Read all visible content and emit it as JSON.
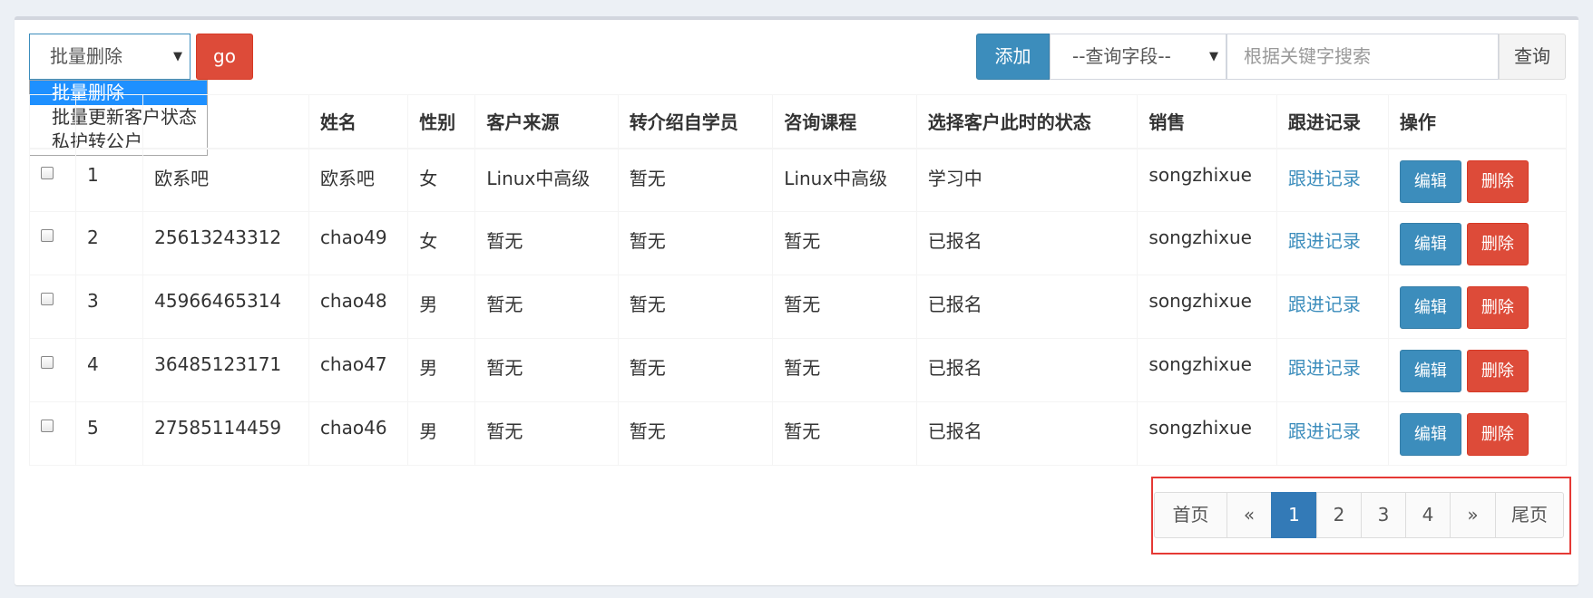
{
  "toolbar": {
    "bulk_selected": "批量删除",
    "bulk_options": [
      "批量删除",
      "批量更新客户状态",
      "私护转公户"
    ],
    "go_label": "go",
    "add_label": "添加",
    "field_select": "--查询字段--",
    "search_placeholder": "根据关键字搜索",
    "query_label": "查询"
  },
  "table": {
    "columns": [
      "",
      "",
      "",
      "姓名",
      "性别",
      "客户来源",
      "转介绍自学员",
      "咨询课程",
      "选择客户此时的状态",
      "销售",
      "跟进记录",
      "操作"
    ],
    "rows": [
      {
        "num": "1",
        "qq": "欧系吧",
        "name": "欧系吧",
        "gender": "女",
        "source": "Linux中高级",
        "referral": "暂无",
        "course": "Linux中高级",
        "status": "学习中",
        "sales": "songzhixue",
        "record": "跟进记录"
      },
      {
        "num": "2",
        "qq": "25613243312",
        "name": "chao49",
        "gender": "女",
        "source": "暂无",
        "referral": "暂无",
        "course": "暂无",
        "status": "已报名",
        "sales": "songzhixue",
        "record": "跟进记录"
      },
      {
        "num": "3",
        "qq": "45966465314",
        "name": "chao48",
        "gender": "男",
        "source": "暂无",
        "referral": "暂无",
        "course": "暂无",
        "status": "已报名",
        "sales": "songzhixue",
        "record": "跟进记录"
      },
      {
        "num": "4",
        "qq": "36485123171",
        "name": "chao47",
        "gender": "男",
        "source": "暂无",
        "referral": "暂无",
        "course": "暂无",
        "status": "已报名",
        "sales": "songzhixue",
        "record": "跟进记录"
      },
      {
        "num": "5",
        "qq": "27585114459",
        "name": "chao46",
        "gender": "男",
        "source": "暂无",
        "referral": "暂无",
        "course": "暂无",
        "status": "已报名",
        "sales": "songzhixue",
        "record": "跟进记录"
      }
    ],
    "edit_label": "编辑",
    "delete_label": "删除"
  },
  "pagination": {
    "items": [
      {
        "label": "首页",
        "active": false
      },
      {
        "label": "«",
        "active": false
      },
      {
        "label": "1",
        "active": true
      },
      {
        "label": "2",
        "active": false
      },
      {
        "label": "3",
        "active": false
      },
      {
        "label": "4",
        "active": false
      },
      {
        "label": "»",
        "active": false
      },
      {
        "label": "尾页",
        "active": false
      }
    ]
  },
  "colors": {
    "primary": "#3c8dbc",
    "danger": "#dd4b39",
    "highlight_box": "#e53935",
    "active_page": "#337ab7"
  }
}
